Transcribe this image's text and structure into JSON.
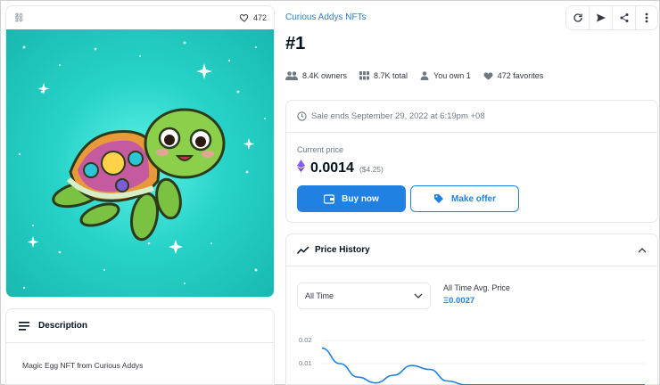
{
  "item": {
    "likes": "472",
    "collection": "Curious Addys NFTs",
    "title": "#1",
    "stats": {
      "owners": "8.4K owners",
      "total": "8.7K total",
      "you_own": "You own 1",
      "favorites": "472 favorites"
    }
  },
  "description": {
    "heading": "Description",
    "text": "Magic Egg NFT from Curious Addys"
  },
  "sale": {
    "ends": "Sale ends September 29, 2022 at 6:19pm +08",
    "current_price_label": "Current price",
    "price": "0.0014",
    "usd": "($4.25)",
    "buy_label": "Buy now",
    "offer_label": "Make offer"
  },
  "price_history": {
    "heading": "Price History",
    "range": "All Time",
    "avg_label": "All Time Avg. Price",
    "avg_value": "Ξ0.0027"
  },
  "chart_data": {
    "type": "line",
    "yticks": [
      "0.02",
      "0.01"
    ],
    "x": [
      0,
      1,
      2,
      3,
      4,
      5,
      6,
      7,
      8,
      9,
      10,
      11,
      12,
      13,
      14,
      15,
      16,
      17,
      18
    ],
    "values": [
      0.02,
      0.012,
      0.005,
      0.002,
      0.006,
      0.011,
      0.009,
      0.003,
      0.001,
      0.001,
      0.001,
      0.001,
      0.001,
      0.001,
      0.001,
      0.001,
      0.001,
      0.001,
      0.001
    ],
    "ylim": [
      0,
      0.024
    ]
  },
  "colors": {
    "accent": "#2081e2",
    "art_bg": "#27d3c8"
  }
}
